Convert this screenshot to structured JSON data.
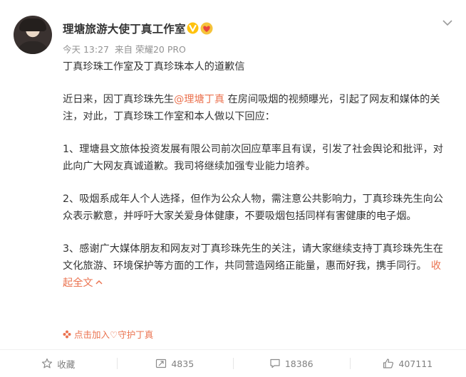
{
  "post": {
    "author": "理塘旅游大使丁真工作室",
    "time": "今天 13:27",
    "source": "来自 荣耀20 PRO",
    "title": "丁真珍珠工作室及丁真珍珠本人的道歉信",
    "p1_a": "近日来，因丁真珍珠先生",
    "p1_mention": "@理塘丁真",
    "p1_b": " 在房间吸烟的视频曝光，引起了网友和媒体的关注，对此，丁真珍珠工作室和本人做以下回应：",
    "p2": "1、理塘县文旅体投资发展有限公司前次回应草率且有误，引发了社会舆论和批评，对此向广大网友真诚道歉。我司将继续加强专业能力培养。",
    "p3": "2、吸烟系成年人个人选择，但作为公众人物，需注意公共影响力，丁真珍珠先生向公众表示歉意，并呼吁大家关爱身体健康，不要吸烟包括同样有害健康的电子烟。",
    "p4": "3、感谢广大媒体朋友和网友对丁真珍珠先生的关注，请大家继续支持丁真珍珠先生在文化旅游、环境保护等方面的工作，共同营造网络正能量，惠而好我，携手同行。",
    "collapse_label": "收起全文",
    "collapse_icon": "chevron-up-icon",
    "guard_text": "点击加入♡守护丁真"
  },
  "toolbar": {
    "favorite_label": "收藏",
    "repost_count": "4835",
    "comment_count": "18386",
    "like_count": "407111"
  },
  "colors": {
    "accent": "#eb7350",
    "verified": "#ffc20e",
    "muted": "#939393"
  }
}
